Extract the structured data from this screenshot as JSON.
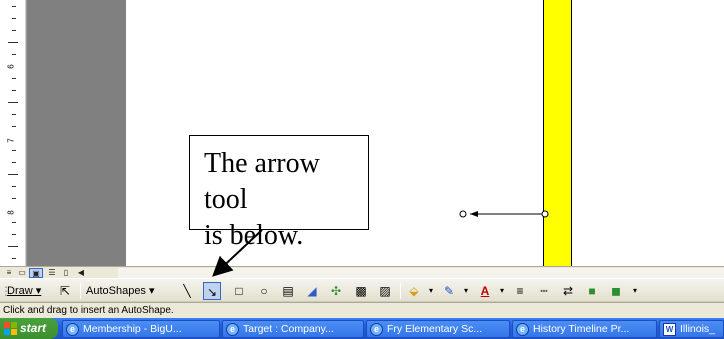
{
  "ruler": {
    "numbers": [
      "6",
      "7",
      "8"
    ]
  },
  "callout": {
    "text_line1": "The arrow tool",
    "text_line2": "is below."
  },
  "colors": {
    "yellow_bar": "#ffff00",
    "taskbar": "#245edb",
    "start_button": "#3c8f2f"
  },
  "view_buttons": [
    "normal-view",
    "web-layout-view",
    "print-layout-view",
    "outline-view",
    "reading-view"
  ],
  "draw_toolbar": {
    "draw_label": "Draw",
    "autoshapes_label": "AutoShapes",
    "tools": [
      "line-icon",
      "arrow-icon",
      "rectangle-icon",
      "oval-icon",
      "text-box-icon",
      "wordart-icon",
      "diagram-icon",
      "clip-art-icon",
      "picture-icon",
      "fill-color-icon",
      "line-color-icon",
      "font-color-icon",
      "line-style-icon",
      "dash-style-icon",
      "arrow-style-icon",
      "shadow-icon",
      "3d-icon"
    ]
  },
  "status": {
    "text": "Click and drag to insert an AutoShape."
  },
  "taskbar": {
    "start_label": "start",
    "tasks": [
      {
        "label": "Membership - BigU...",
        "icon": "ie-icon"
      },
      {
        "label": "Target : Company...",
        "icon": "ie-icon"
      },
      {
        "label": "Fry Elementary Sc...",
        "icon": "ie-icon"
      },
      {
        "label": "History Timeline Pr...",
        "icon": "ie-icon"
      },
      {
        "label": "Illinois_",
        "icon": "word-icon"
      }
    ]
  }
}
